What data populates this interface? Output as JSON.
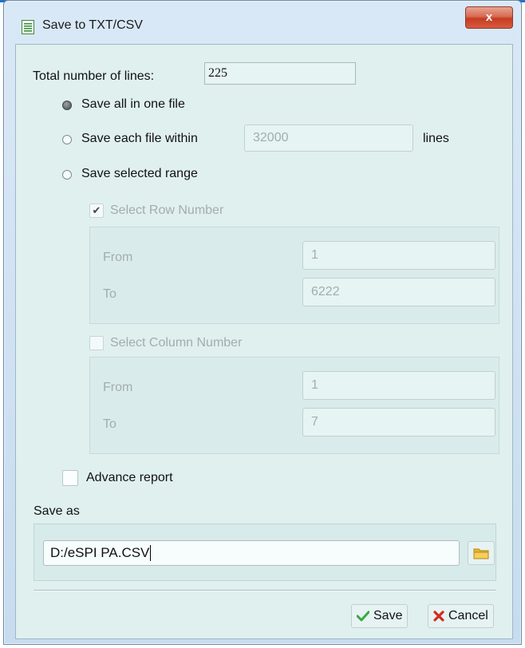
{
  "window": {
    "title": "Save to TXT/CSV",
    "close_label": "x"
  },
  "total_lines": {
    "label": "Total number of lines:",
    "value": "225"
  },
  "options": {
    "save_all_label": "Save all in one file",
    "save_each_label": "Save each file within",
    "save_each_value": "32000",
    "save_each_suffix": "lines",
    "save_range_label": "Save selected range",
    "selected": "save_all"
  },
  "row_range": {
    "label": "Select Row Number",
    "checked": true,
    "from_label": "From",
    "from_value": "1",
    "to_label": "To",
    "to_value": "6222"
  },
  "column_range": {
    "label": "Select Column Number",
    "checked": false,
    "from_label": "From",
    "from_value": "1",
    "to_label": "To",
    "to_value": "7"
  },
  "advance_report": {
    "label": "Advance report",
    "checked": false
  },
  "save_as": {
    "label": "Save as",
    "path": "D:/eSPI PA.CSV",
    "browse_icon": "folder-icon"
  },
  "buttons": {
    "save_label": "Save",
    "cancel_label": "Cancel"
  },
  "colors": {
    "accent": "#1f73c7",
    "close": "#c43d22",
    "save_check": "#3aa845",
    "cancel_x": "#d22b1f",
    "folder": "#e9b52f"
  }
}
